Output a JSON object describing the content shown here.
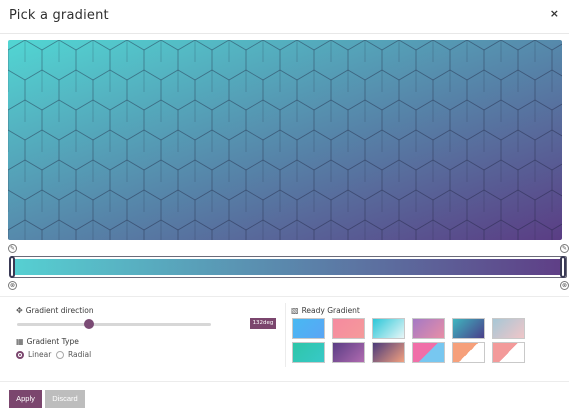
{
  "dialog": {
    "title": "Pick a gradient",
    "close_label": "×"
  },
  "gradient": {
    "angle_deg": 132,
    "angle_label": "132deg",
    "stops": [
      "#52d6d3",
      "#5a3d84"
    ],
    "track_colors": [
      "#56d0d2",
      "#5f3e86"
    ]
  },
  "direction": {
    "label": "Gradient direction",
    "icon": "move-icon",
    "value_fraction": 0.37
  },
  "type": {
    "label": "Gradient Type",
    "icon": "type-icon",
    "options": [
      {
        "label": "Linear",
        "checked": true
      },
      {
        "label": "Radial",
        "checked": false
      }
    ]
  },
  "ready": {
    "label": "Ready Gradient",
    "icon": "image-icon",
    "swatches": [
      {
        "from": "#48b9f2",
        "to": "#5aa5f5"
      },
      {
        "from": "#f58aa0",
        "to": "#f59a9a"
      },
      {
        "from": "#2cc7d8",
        "to": "#e8f6f7"
      },
      {
        "from": "#a479c5",
        "to": "#e88ea6"
      },
      {
        "from": "#3fb6bf",
        "to": "#4a3f8a"
      },
      {
        "from": "#a7c7d6",
        "to": "#f0c6c8"
      },
      {
        "from": "#2ec6a8",
        "to": "#38c8c8"
      },
      {
        "from": "#5a3d84",
        "to": "#b06bb0"
      },
      {
        "from": "#4a3b7a",
        "to": "#f2a07f"
      },
      {
        "from": "#f06fa8",
        "to": "#77c7f0"
      },
      {
        "from": "#f6a07b",
        "to": "#ffffff"
      },
      {
        "from": "#f39a9a",
        "to": "#ffffff"
      }
    ]
  },
  "actions": {
    "apply": "Apply",
    "discard": "Discard"
  }
}
